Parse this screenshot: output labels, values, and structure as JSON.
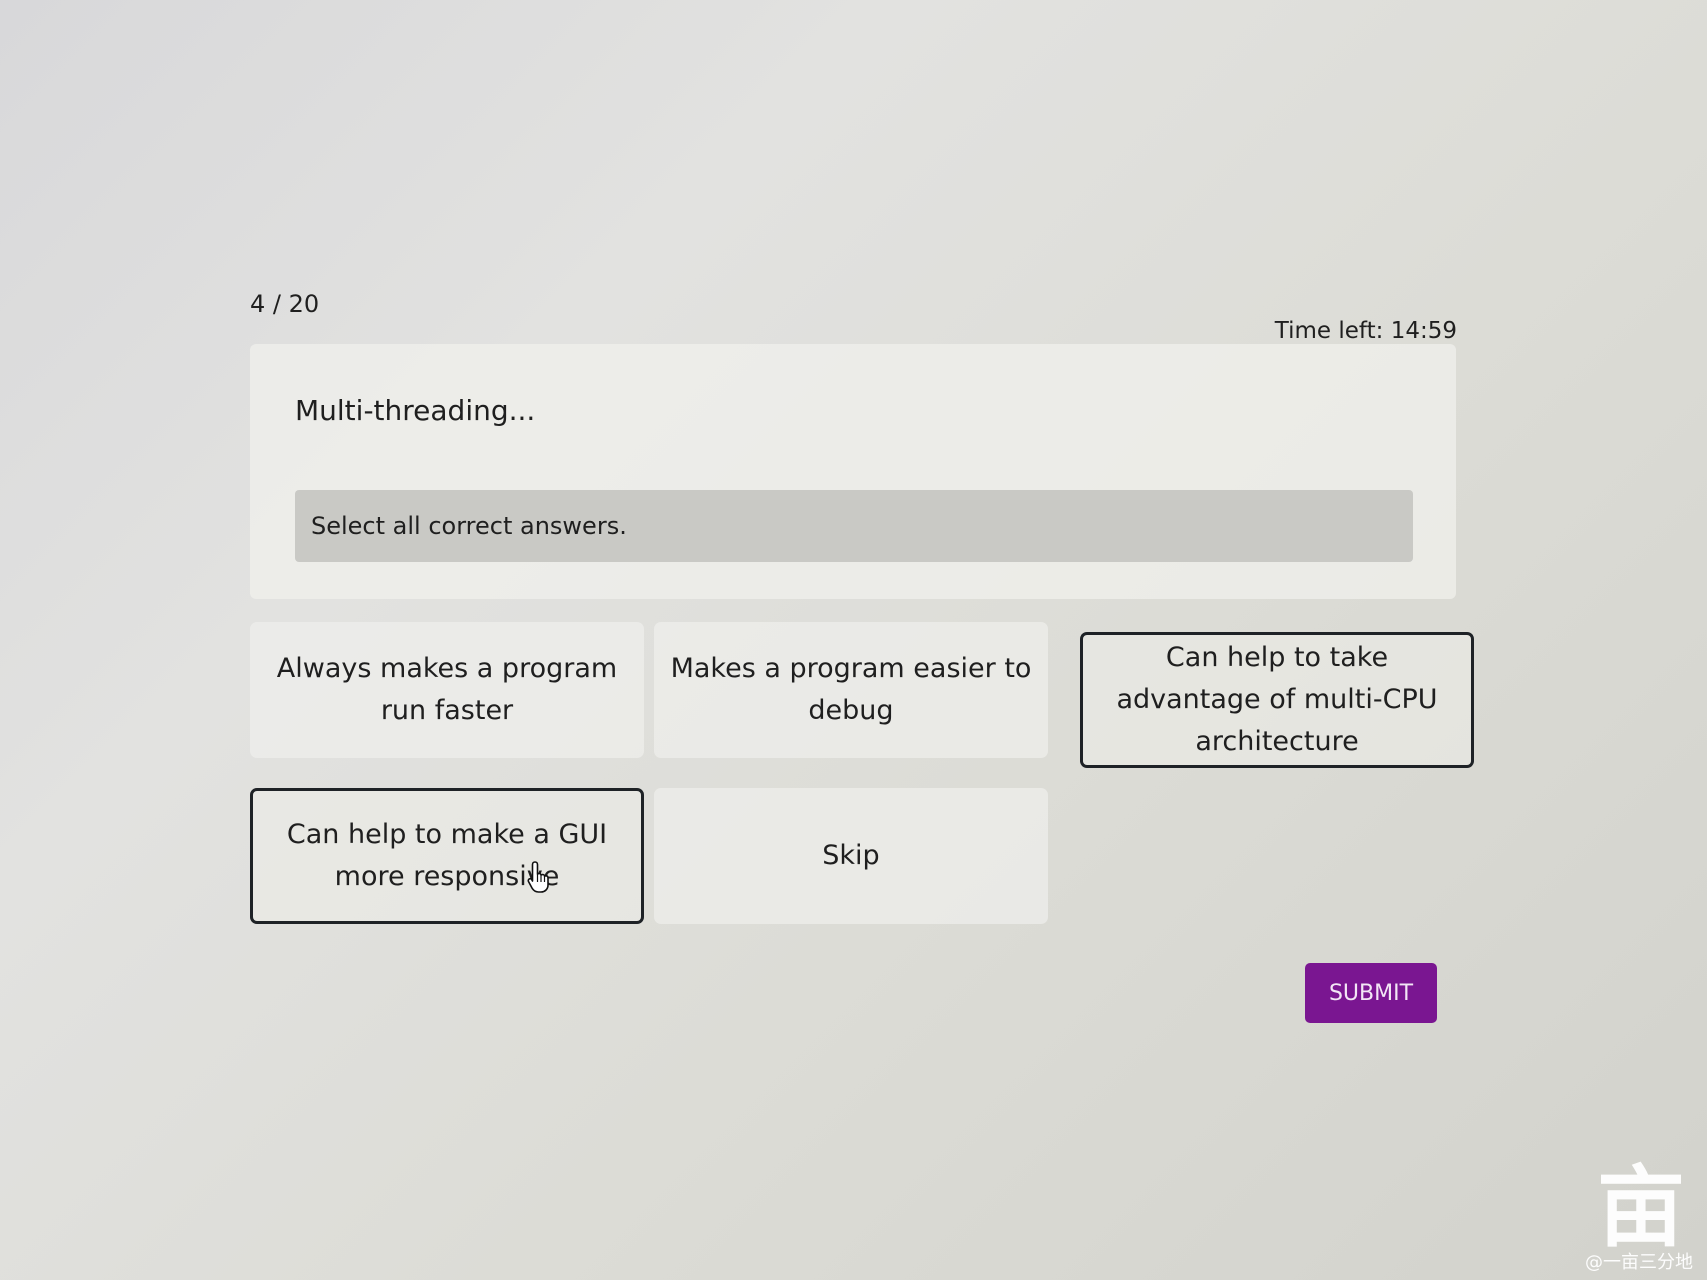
{
  "quiz": {
    "progress": "4 / 20",
    "timer": "Time left: 14:59",
    "question": "Multi-threading...",
    "instruction": "Select all correct answers.",
    "options": [
      {
        "label": "Always makes a program run faster",
        "selected": false
      },
      {
        "label": "Makes a program easier to debug",
        "selected": false
      },
      {
        "label": "Can help to take advantage of multi-CPU architecture",
        "selected": true
      },
      {
        "label": "Can help to make a GUI more responsive",
        "selected": true
      },
      {
        "label": "Skip",
        "selected": false
      }
    ],
    "submit_label": "SUBMIT"
  },
  "colors": {
    "accent": "#7a1691",
    "selected_border": "#1e2226"
  },
  "icons": {
    "cursor": "hand-pointer-icon"
  },
  "watermark": {
    "glyph": "亩",
    "text": "@一亩三分地"
  }
}
